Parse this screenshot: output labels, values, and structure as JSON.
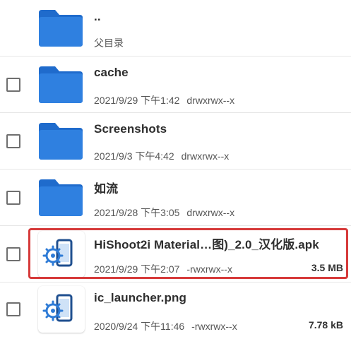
{
  "colors": {
    "folder": "#2f80e0",
    "folder_tab": "#1f6bcc",
    "highlight": "#d63a3a",
    "apk_icon": "#2e7bd6"
  },
  "parent_row": {
    "name": "..",
    "subtitle": "父目录",
    "icon": "folder-icon"
  },
  "files": [
    {
      "name": "cache",
      "date": "2021/9/29 下午1:42",
      "permissions": "drwxrwx--x",
      "size": "",
      "icon": "folder-icon"
    },
    {
      "name": "Screenshots",
      "date": "2021/9/3 下午4:42",
      "permissions": "drwxrwx--x",
      "size": "",
      "icon": "folder-icon"
    },
    {
      "name": "如流",
      "date": "2021/9/28 下午3:05",
      "permissions": "drwxrwx--x",
      "size": "",
      "icon": "folder-icon"
    },
    {
      "name": "HiShoot2i Material…图)_2.0_汉化版.apk",
      "date": "2021/9/29 下午2:07",
      "permissions": "-rwxrwx--x",
      "size": "3.5 MB",
      "icon": "apk-phone-gear-icon",
      "highlighted": true
    },
    {
      "name": "ic_launcher.png",
      "date": "2020/9/24 下午11:46",
      "permissions": "-rwxrwx--x",
      "size": "7.78 kB",
      "icon": "image-phone-gear-icon"
    }
  ]
}
